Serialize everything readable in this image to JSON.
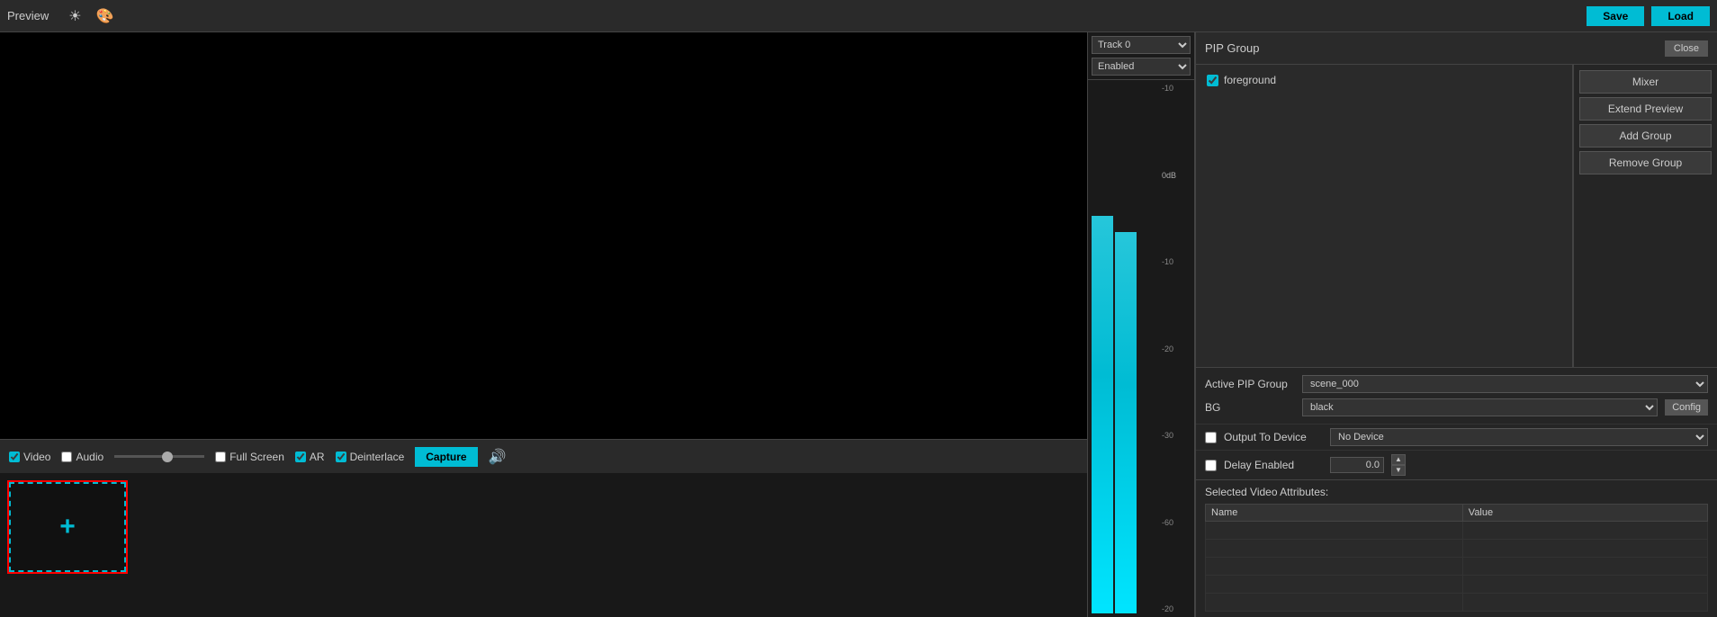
{
  "topBar": {
    "title": "Preview",
    "saveLabel": "Save",
    "loadLabel": "Load"
  },
  "controls": {
    "videoLabel": "Video",
    "audioLabel": "Audio",
    "fullScreenLabel": "Full Screen",
    "arLabel": "AR",
    "deinterlaceLabel": "Deinterlace",
    "captureLabel": "Capture",
    "sliderValue": 60
  },
  "audioMeter": {
    "trackLabel": "Track",
    "trackOptions": [
      "Track 0"
    ],
    "enabledOptions": [
      "Enabled"
    ],
    "scaleLabels": [
      "-10",
      "-20",
      "-30",
      "-60"
    ],
    "dbLabel": "0dB",
    "rightLabel": "-10",
    "bottomLabel": "-20"
  },
  "pipGroup": {
    "title": "PIP Group",
    "closeLabel": "Close",
    "treeItem": "foreground",
    "mixerLabel": "Mixer",
    "extendPreviewLabel": "Extend Preview",
    "addGroupLabel": "Add Group",
    "removeGroupLabel": "Remove Group",
    "activePipGroupLabel": "Active PIP Group",
    "activePipGroupValue": "scene_000",
    "bgLabel": "BG",
    "bgValue": "black",
    "configLabel": "Config",
    "outputToDeviceLabel": "Output To Device",
    "noDeviceLabel": "No Device",
    "delayEnabledLabel": "Delay Enabled",
    "delayValue": "0.0",
    "selectedVideoAttrTitle": "Selected Video Attributes:",
    "nameColLabel": "Name",
    "valueColLabel": "Value",
    "attrRows": [
      {
        "name": "",
        "value": ""
      },
      {
        "name": "",
        "value": ""
      },
      {
        "name": "",
        "value": ""
      },
      {
        "name": "",
        "value": ""
      },
      {
        "name": "",
        "value": ""
      }
    ]
  },
  "thumbnail": {
    "plusLabel": "+"
  }
}
